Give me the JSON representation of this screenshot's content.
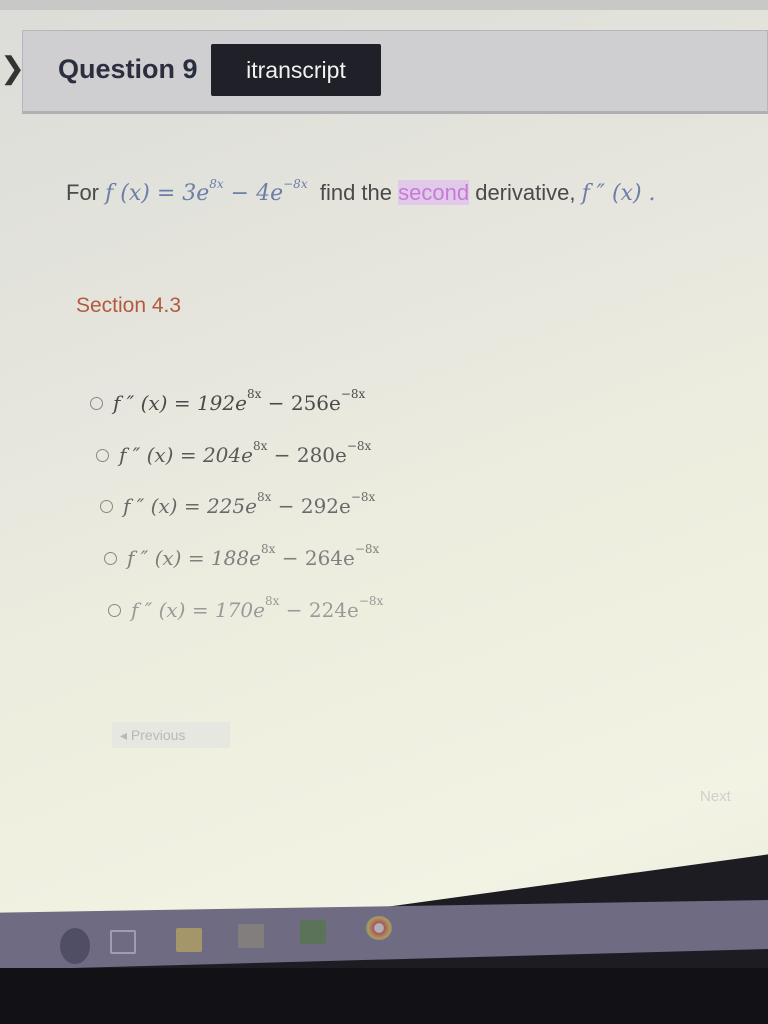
{
  "header": {
    "question_label": "Question 9",
    "transcript_button": "itranscript"
  },
  "problem": {
    "prefix": "For",
    "func": "f (x) = 3e",
    "exp1": "8x",
    "middle": " − 4e",
    "exp2": "−8x",
    "text1": "find the",
    "highlight": "second",
    "text2": "derivative,",
    "deriv": "f ″ (x) ."
  },
  "section": "Section 4.3",
  "options": [
    {
      "lhs": "f ″ (x) = 192e",
      "exp1": "8x",
      "mid": " − 256e",
      "exp2": "−8x"
    },
    {
      "lhs": "f ″ (x) = 204e",
      "exp1": "8x",
      "mid": " − 280e",
      "exp2": "−8x"
    },
    {
      "lhs": "f ″ (x) = 225e",
      "exp1": "8x",
      "mid": " − 292e",
      "exp2": "−8x"
    },
    {
      "lhs": "f ″ (x) = 188e",
      "exp1": "8x",
      "mid": " − 264e",
      "exp2": "−8x"
    },
    {
      "lhs": "f ″ (x) = 170e",
      "exp1": "8x",
      "mid": " − 224e",
      "exp2": "−8x"
    }
  ],
  "nav": {
    "previous": "◂ Previous",
    "next": "Next"
  },
  "taskbar": {
    "icons": [
      "person-icon",
      "task-view-icon",
      "file-explorer-icon",
      "store-icon",
      "app-icon",
      "chrome-icon"
    ]
  }
}
